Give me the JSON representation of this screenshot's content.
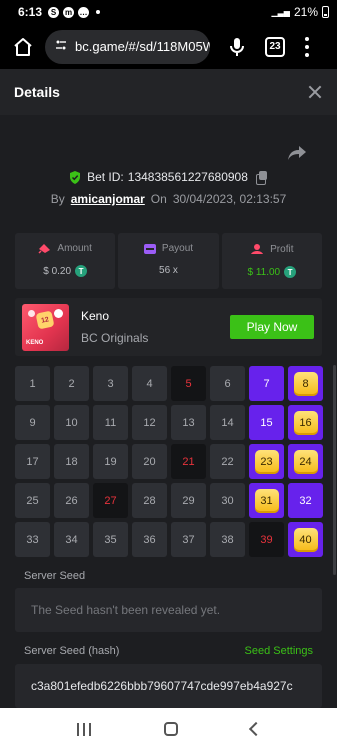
{
  "status_bar": {
    "time": "6:13",
    "battery": "21%",
    "net": "4G+ LTE"
  },
  "browser": {
    "url": "bc.game/#/sd/118M05W",
    "tab_count": "23"
  },
  "modal": {
    "title": "Details"
  },
  "bet": {
    "id_label": "Bet ID:",
    "id": "134838561227680908",
    "by_label": "By",
    "user": "amicanjomar",
    "on_label": "On",
    "date": "30/04/2023, 02:13:57"
  },
  "stats": {
    "amount_label": "Amount",
    "amount_value": "$ 0.20",
    "payout_label": "Payout",
    "payout_value": "56 x",
    "profit_label": "Profit",
    "profit_value": "$ 11.00",
    "coin_symbol": "T"
  },
  "game": {
    "name": "Keno",
    "provider": "BC Originals",
    "play_label": "Play Now",
    "thumb_label": "KENO",
    "thumb_ball": "12"
  },
  "grid": [
    {
      "n": "1",
      "s": "normal"
    },
    {
      "n": "2",
      "s": "normal"
    },
    {
      "n": "3",
      "s": "normal"
    },
    {
      "n": "4",
      "s": "normal"
    },
    {
      "n": "5",
      "s": "miss"
    },
    {
      "n": "6",
      "s": "normal"
    },
    {
      "n": "7",
      "s": "pick"
    },
    {
      "n": "8",
      "s": "hit"
    },
    {
      "n": "9",
      "s": "normal"
    },
    {
      "n": "10",
      "s": "normal"
    },
    {
      "n": "11",
      "s": "normal"
    },
    {
      "n": "12",
      "s": "normal"
    },
    {
      "n": "13",
      "s": "normal"
    },
    {
      "n": "14",
      "s": "normal"
    },
    {
      "n": "15",
      "s": "pick"
    },
    {
      "n": "16",
      "s": "hit"
    },
    {
      "n": "17",
      "s": "normal"
    },
    {
      "n": "18",
      "s": "normal"
    },
    {
      "n": "19",
      "s": "normal"
    },
    {
      "n": "20",
      "s": "normal"
    },
    {
      "n": "21",
      "s": "miss"
    },
    {
      "n": "22",
      "s": "normal"
    },
    {
      "n": "23",
      "s": "hit"
    },
    {
      "n": "24",
      "s": "hit"
    },
    {
      "n": "25",
      "s": "normal"
    },
    {
      "n": "26",
      "s": "normal"
    },
    {
      "n": "27",
      "s": "miss"
    },
    {
      "n": "28",
      "s": "normal"
    },
    {
      "n": "29",
      "s": "normal"
    },
    {
      "n": "30",
      "s": "normal"
    },
    {
      "n": "31",
      "s": "hit"
    },
    {
      "n": "32",
      "s": "pick"
    },
    {
      "n": "33",
      "s": "normal"
    },
    {
      "n": "34",
      "s": "normal"
    },
    {
      "n": "35",
      "s": "normal"
    },
    {
      "n": "36",
      "s": "normal"
    },
    {
      "n": "37",
      "s": "normal"
    },
    {
      "n": "38",
      "s": "normal"
    },
    {
      "n": "39",
      "s": "miss"
    },
    {
      "n": "40",
      "s": "hit"
    }
  ],
  "seed": {
    "server_label": "Server Seed",
    "server_value": "The Seed hasn't been revealed yet.",
    "hash_label": "Server Seed (hash)",
    "settings_label": "Seed Settings",
    "hash_value": "c3a801efedb6226bbb79607747cde997eb4a927c"
  },
  "colors": {
    "accent_green": "#3bc117",
    "pick_purple": "#6722ec",
    "miss_red": "#e8333c",
    "gem_gold": "#f5b915"
  }
}
